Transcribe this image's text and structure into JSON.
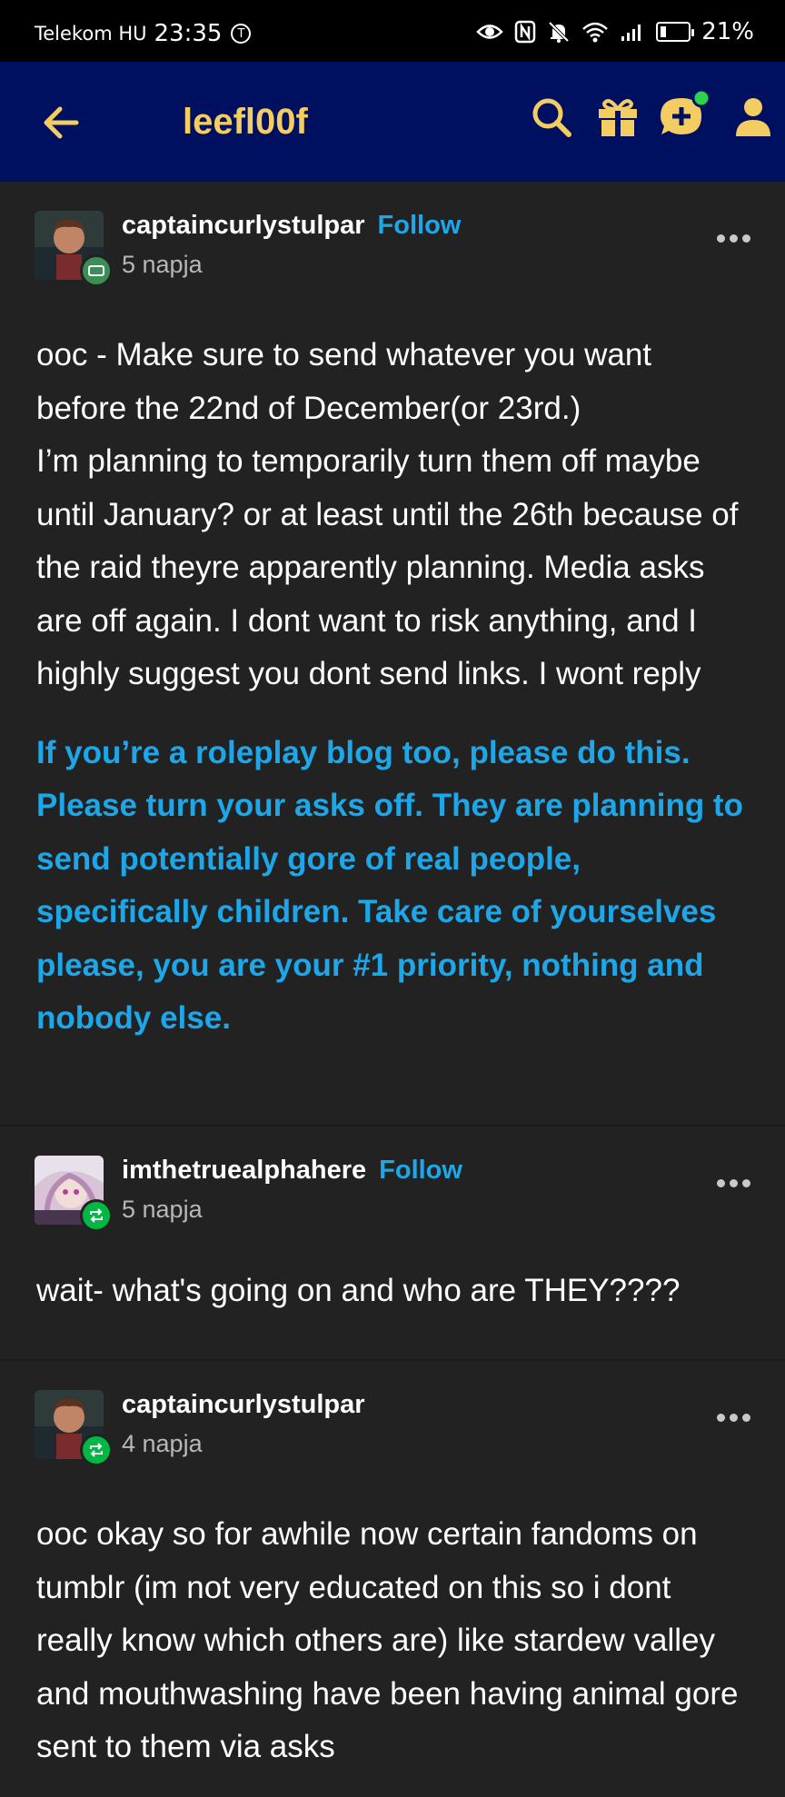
{
  "status_bar": {
    "carrier": "Telekom HU",
    "time": "23:35",
    "battery": "21%",
    "battery_level": 0.21
  },
  "nav": {
    "title": "leefl00f",
    "icons": [
      "back-arrow-icon",
      "search-icon",
      "gift-icon",
      "new-chat-icon",
      "account-icon"
    ],
    "accent_color": "#f3cc62",
    "bar_color": "#001061"
  },
  "posts": [
    {
      "username": "captaincurlystulpar",
      "follow_label": "Follow",
      "time": "5 napja",
      "paragraph_1": "ooc - Make sure to send whatever you want before the 22nd of December(or 23rd.)",
      "paragraph_2": "I’m planning to temporarily turn them off maybe until January? or at least until the 26th because of the raid theyre apparently planning. Media asks are off again. I dont want to risk anything, and I highly suggest you dont send links. I wont reply",
      "highlight": "If you’re a roleplay blog too, please do this. Please turn your asks off. They are planning to send potentially gore of real people, specifically children. Take care of yourselves please, you are your #1 priority, nothing and nobody else."
    },
    {
      "username": "imthetruealphahere",
      "follow_label": "Follow",
      "time": "5 napja",
      "paragraph_1": "wait- what's going on and who are THEY????"
    },
    {
      "username": "captaincurlystulpar",
      "time": "4 napja",
      "paragraph_1": "ooc okay so for awhile now certain fandoms on tumblr (im not very educated on this so i dont really know which others are) like stardew valley and mouthwashing have been having animal gore sent to them via asks"
    }
  ],
  "colors": {
    "link_blue": "#1ea7e8",
    "reblog_green": "#00b843",
    "background": "#222222"
  }
}
